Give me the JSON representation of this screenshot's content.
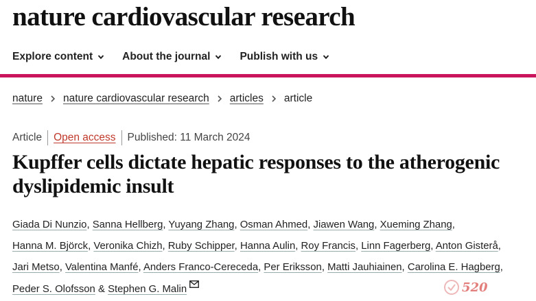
{
  "journal": {
    "name": "nature cardiovascular research"
  },
  "colors": {
    "accent": "#c9145b",
    "open_access": "#c0392b"
  },
  "nav": {
    "items": [
      {
        "label": "Explore content"
      },
      {
        "label": "About the journal"
      },
      {
        "label": "Publish with us"
      }
    ]
  },
  "breadcrumb": {
    "items": [
      "nature",
      "nature cardiovascular research",
      "articles"
    ],
    "current": "article"
  },
  "meta": {
    "type": "Article",
    "access": "Open access",
    "published": "Published: 11 March 2024"
  },
  "article": {
    "title": "Kupffer cells dictate hepatic responses to the atherogenic dyslipidemic insult",
    "authors": [
      "Giada Di Nunzio",
      "Sanna Hellberg",
      "Yuyang Zhang",
      "Osman Ahmed",
      "Jiawen Wang",
      "Xueming Zhang",
      "Hanna M. Björck",
      "Veronika Chizh",
      "Ruby Schipper",
      "Hanna Aulin",
      "Roy Francis",
      "Linn Fagerberg",
      "Anton Gisterå",
      "Jari Metso",
      "Valentina Manfé",
      "Anders Franco-Cereceda",
      "Per Eriksson",
      "Matti Jauhiainen",
      "Carolina E. Hagberg",
      "Peder S. Olofsson",
      "Stephen G. Malin"
    ],
    "conjunction": "&"
  },
  "watermark": {
    "text": "520",
    "icon": "watermark-logo"
  }
}
